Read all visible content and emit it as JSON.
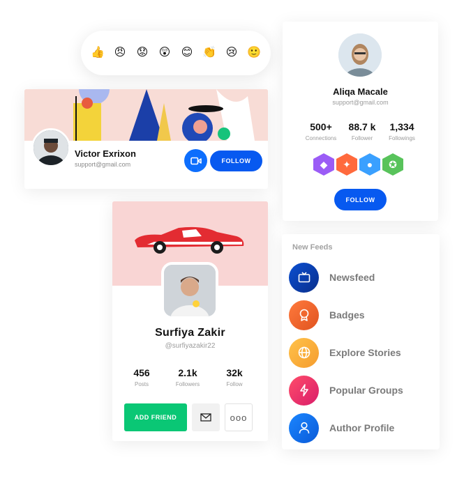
{
  "reactions": [
    {
      "icon": "thumbs-up-emoji",
      "glyph": "👍",
      "bg": "#ffd34d"
    },
    {
      "icon": "angry-emoji",
      "glyph": "😠",
      "bg": "#ffc94a"
    },
    {
      "icon": "worried-emoji",
      "glyph": "😟",
      "bg": "#ffc94a"
    },
    {
      "icon": "surprised-emoji",
      "glyph": "😲",
      "bg": "#ffc94a"
    },
    {
      "icon": "smiling-emoji",
      "glyph": "😊",
      "bg": "#ffc94a"
    },
    {
      "icon": "clapping-emoji",
      "glyph": "👏",
      "bg": "#ffd34d"
    },
    {
      "icon": "crying-emoji",
      "glyph": "😢",
      "bg": "#ffc94a"
    },
    {
      "icon": "smile-emoji",
      "glyph": "🙂",
      "bg": "#ffc94a"
    }
  ],
  "victor": {
    "name": "Victor Exrixon",
    "email": "support@gmail.com",
    "follow_label": "FOLLOW"
  },
  "aliqa": {
    "name": "Aliqa Macale",
    "email": "support@gmail.com",
    "stats": [
      {
        "value": "500+",
        "label": "Connections"
      },
      {
        "value": "88.7 k",
        "label": "Follower"
      },
      {
        "value": "1,334",
        "label": "Followings"
      }
    ],
    "badges": [
      {
        "icon": "diamond-badge-icon",
        "color": "#9b5cf6"
      },
      {
        "icon": "fire-badge-icon",
        "color": "#ff6a3d"
      },
      {
        "icon": "medal-badge-icon",
        "color": "#3aa0ff"
      },
      {
        "icon": "first-place-badge-icon",
        "color": "#58c35b"
      }
    ],
    "follow_label": "FOLLOW"
  },
  "surfiya": {
    "name": "Surfiya Zakir",
    "handle": "@surfiyazakir22",
    "stats": [
      {
        "value": "456",
        "label": "Posts"
      },
      {
        "value": "2.1k",
        "label": "Followers"
      },
      {
        "value": "32k",
        "label": "Follow"
      }
    ],
    "add_friend_label": "ADD FRIEND",
    "more_label": "ooo"
  },
  "feeds": {
    "title": "New Feeds",
    "items": [
      {
        "label": "Newsfeed",
        "icon": "tv-icon",
        "from": "#0b4fd1",
        "to": "#0a2f8c"
      },
      {
        "label": "Badges",
        "icon": "award-icon",
        "from": "#ff7a3d",
        "to": "#e0531f"
      },
      {
        "label": "Explore Stories",
        "icon": "globe-icon",
        "from": "#ffc24a",
        "to": "#f59c2e"
      },
      {
        "label": "Popular Groups",
        "icon": "lightning-icon",
        "from": "#ff4d6a",
        "to": "#d91d6a"
      },
      {
        "label": "Author Profile",
        "icon": "user-icon",
        "from": "#1b86ff",
        "to": "#0a5ad8"
      }
    ]
  },
  "colors": {
    "primary_blue": "#0759f0",
    "green": "#0ac775"
  }
}
